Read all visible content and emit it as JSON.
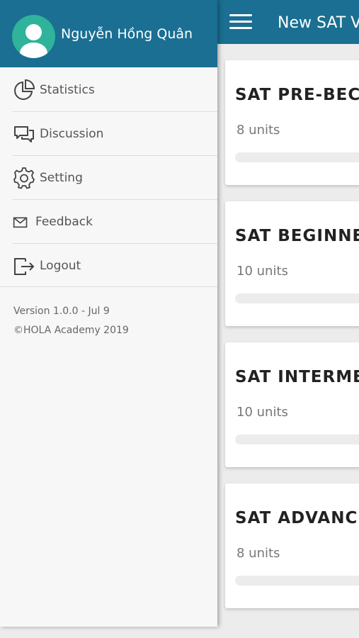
{
  "appbar": {
    "title": "New SAT V",
    "menu_icon": "hamburger-icon"
  },
  "courses": [
    {
      "title": "SAT PRE-BEC",
      "units": "8 units",
      "progress": 0
    },
    {
      "title": "SAT BEGINNE",
      "units": "10 units",
      "progress": 0
    },
    {
      "title": "SAT INTERME",
      "units": "10 units",
      "progress": 0
    },
    {
      "title": "SAT ADVANC",
      "units": "8 units",
      "progress": 0
    }
  ],
  "drawer": {
    "user_name": "Nguyễn Hồng Quân",
    "avatar_icon": "user-avatar-icon",
    "menu": [
      {
        "label": "Statistics",
        "icon": "pie-chart-icon"
      },
      {
        "label": "Discussion",
        "icon": "chat-bubbles-icon"
      },
      {
        "label": "Setting",
        "icon": "gear-icon"
      },
      {
        "label": "Feedback",
        "icon": "envelope-icon"
      },
      {
        "label": "Logout",
        "icon": "logout-icon"
      }
    ],
    "version": "Version 1.0.0 - Jul 9",
    "copyright": "©HOLA Academy 2019"
  },
  "colors": {
    "primary": "#1a6f92",
    "avatar": "#2fb39a",
    "drawer_bg": "#f7f7f7",
    "progress_track": "#ececec"
  }
}
